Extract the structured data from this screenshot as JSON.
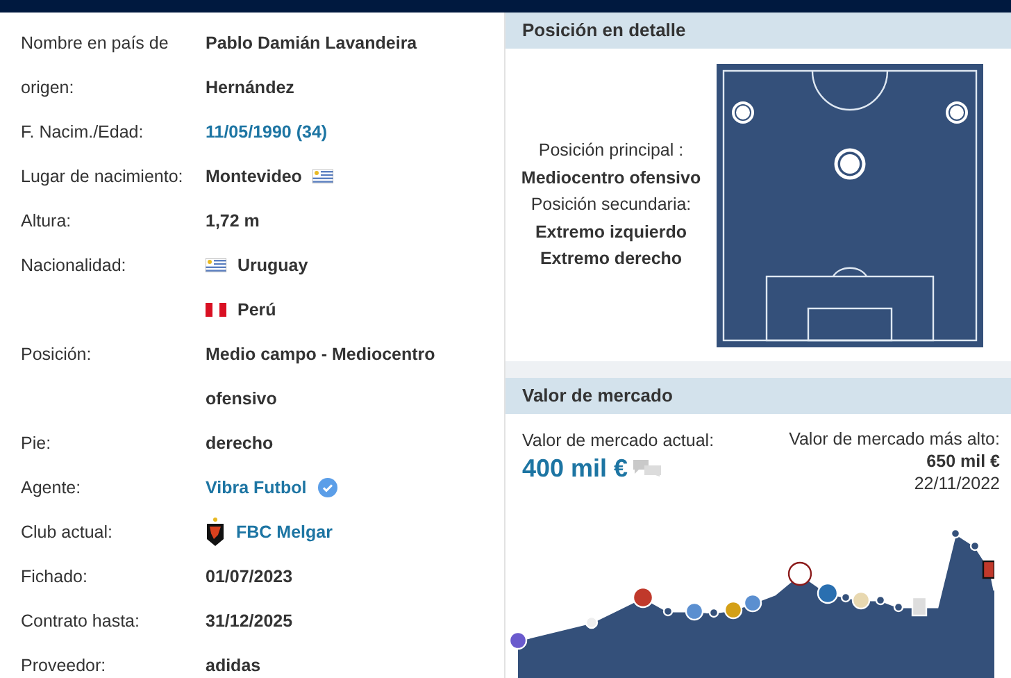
{
  "player_data": [
    {
      "label": "Nombre en país de origen:",
      "values": [
        {
          "text": "Pablo Damián Lavandeira Hernández",
          "kind": "text"
        }
      ]
    },
    {
      "label": "F. Nacim./Edad:",
      "values": [
        {
          "text": "11/05/1990 (34)",
          "kind": "link"
        }
      ]
    },
    {
      "label": "Lugar de nacimiento:",
      "values": [
        {
          "text": "Montevideo",
          "kind": "text"
        },
        {
          "kind": "uruguayflag"
        }
      ]
    },
    {
      "label": "Altura:",
      "values": [
        {
          "text": "1,72 m",
          "kind": "text"
        }
      ]
    },
    {
      "label": "Nacionalidad:",
      "lines": [
        [
          {
            "kind": "uruguayflag"
          },
          {
            "text": "Uruguay",
            "kind": "text"
          }
        ],
        [
          {
            "kind": "peruflag"
          },
          {
            "text": "Perú",
            "kind": "text"
          }
        ]
      ]
    },
    {
      "label": "Posición:",
      "values": [
        {
          "text": "Medio campo - Mediocentro ofensivo",
          "kind": "text"
        }
      ]
    },
    {
      "label": "Pie:",
      "values": [
        {
          "text": "derecho",
          "kind": "text"
        }
      ]
    },
    {
      "label": "Agente:",
      "values": [
        {
          "text": "Vibra Futbol",
          "kind": "link"
        },
        {
          "kind": "verified"
        }
      ]
    },
    {
      "label": "Club actual:",
      "values": [
        {
          "kind": "crest"
        },
        {
          "text": "FBC Melgar",
          "kind": "link"
        }
      ]
    },
    {
      "label": "Fichado:",
      "values": [
        {
          "text": "01/07/2023",
          "kind": "text"
        }
      ]
    },
    {
      "label": "Contrato hasta:",
      "values": [
        {
          "text": "31/12/2025",
          "kind": "text"
        }
      ]
    },
    {
      "label": "Proveedor:",
      "values": [
        {
          "text": "adidas",
          "kind": "text"
        }
      ]
    }
  ],
  "position_detail": {
    "title": "Posición en detalle",
    "lines": [
      {
        "text": "Posición principal :",
        "kind": "label"
      },
      {
        "text": "Mediocentro ofensivo",
        "kind": "value"
      },
      {
        "text": "Posición secundaria:",
        "kind": "label"
      },
      {
        "text": "Extremo izquierdo",
        "kind": "value"
      },
      {
        "text": "Extremo derecho",
        "kind": "value"
      }
    ]
  },
  "market_value": {
    "title": "Valor de mercado",
    "current_label": "Valor de mercado actual:",
    "current_value": "400 mil €",
    "highest_label": "Valor de mercado más alto:",
    "highest_value": "650 mil €",
    "highest_date": "22/11/2022"
  }
}
